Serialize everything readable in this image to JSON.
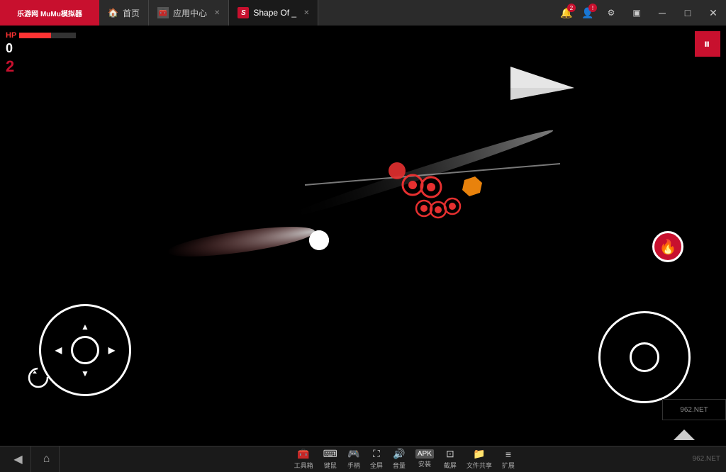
{
  "titlebar": {
    "logo": "乐游网 MuMu模拟器",
    "tabs": [
      {
        "id": "home",
        "icon": "🏠",
        "label": "首页",
        "active": false,
        "closable": false
      },
      {
        "id": "appstore",
        "icon": "🧰",
        "label": "应用中心",
        "active": false,
        "closable": true
      },
      {
        "id": "game",
        "icon": "S",
        "label": "Shape Of _",
        "active": true,
        "closable": true
      }
    ],
    "window_controls": [
      "notification",
      "profile",
      "settings",
      "record",
      "minimize",
      "maximize",
      "close"
    ],
    "notification_count": "2"
  },
  "game": {
    "hp_label": "HP",
    "score": "0",
    "level": "2",
    "pause_label": "⏸"
  },
  "toolbar": {
    "nav": [
      "◀",
      "⌂"
    ],
    "buttons": [
      {
        "icon": "🧰",
        "label": "工具箱"
      },
      {
        "icon": "⌨",
        "label": "键鼠"
      },
      {
        "icon": "🎮",
        "label": "手柄"
      },
      {
        "icon": "⛶",
        "label": "全屏"
      },
      {
        "icon": "🔊",
        "label": "音量"
      },
      {
        "icon": "APK",
        "label": "安装"
      },
      {
        "icon": "⊡",
        "label": "截屏"
      },
      {
        "icon": "📁",
        "label": "文件共享"
      },
      {
        "icon": "≡",
        "label": "扩展"
      }
    ],
    "watermark": "962.NET"
  }
}
